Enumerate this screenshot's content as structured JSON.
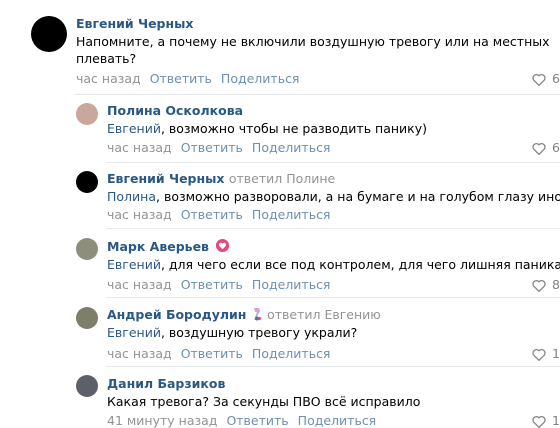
{
  "comments": [
    {
      "author": "Евгений Черных",
      "text_lines": [
        "Напомните, а почему не включили воздушную тревогу или на местных",
        "плевать?"
      ],
      "time": "час назад",
      "reply": "Ответить",
      "share": "Поделиться",
      "likes": "6",
      "avatar_color": "#000000"
    },
    {
      "author": "Полина Осколкова",
      "mention": "Евгений",
      "text_rest": ", возможно чтобы не разводить панику)",
      "time": "час назад",
      "reply": "Ответить",
      "share": "Поделиться",
      "likes": "6",
      "avatar_color": "#c9a79a"
    },
    {
      "author": "Евгений Черных",
      "replied_to": "ответил Полине",
      "mention": "Полина",
      "text_rest": ", возможно разворовали, а на бумаге и на голубом глазу иное?",
      "time": "час назад",
      "reply": "Ответить",
      "share": "Поделиться",
      "avatar_color": "#000000"
    },
    {
      "author": "Марк Аверьев",
      "mention": "Евгений",
      "text_rest": ", для чего если все под контролем, для чего лишняя паника",
      "time": "час назад",
      "reply": "Ответить",
      "share": "Поделиться",
      "likes": "8",
      "avatar_color": "#8d8f7c",
      "badge_color": "#e8467c"
    },
    {
      "author": "Андрей Бородулин",
      "replied_to": "ответил Евгению",
      "mention": "Евгений",
      "text_rest": ", воздушную тревогу украли?",
      "time": "час назад",
      "reply": "Ответить",
      "share": "Поделиться",
      "likes": "1",
      "avatar_color": "#7d7f6a"
    },
    {
      "author": "Данил Барзиков",
      "text": "Какая тревога? За секунды ПВО всё исправило",
      "time": "41 минуту назад",
      "reply": "Ответить",
      "share": "Поделиться",
      "likes": "1",
      "avatar_color": "#5d6068"
    }
  ]
}
